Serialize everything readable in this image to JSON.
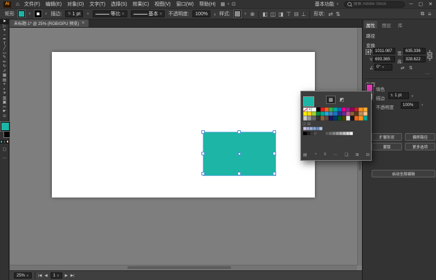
{
  "titlebar": {
    "logo": "Ai",
    "home_icon": "⌂",
    "menus": [
      "文件(F)",
      "编辑(E)",
      "对象(O)",
      "文字(T)",
      "选择(S)",
      "效果(C)",
      "视图(V)",
      "窗口(W)",
      "帮助(H)"
    ],
    "arrange_icon": "▦",
    "share_icon": "⊡",
    "workspace": "基本功能",
    "search_placeholder": "搜索 Adobe Stock",
    "minimize": "─",
    "restore": "▢",
    "close": "✕"
  },
  "control_bar": {
    "context_label": "矩形",
    "fill_color": "#1db5a6",
    "stroke_label": "描边:",
    "stroke_weight": "1 pt",
    "profile_value": "等比",
    "brush_value": "基本",
    "opacity_label": "不透明度:",
    "opacity_value": "100%",
    "opacity_more": "›",
    "style_label": "样式:",
    "doc_icon": "⊕",
    "align_icons": [
      {
        "g": "◧",
        "n": "align-left-icon"
      },
      {
        "g": "◫",
        "n": "align-center-horizontal-icon"
      },
      {
        "g": "◨",
        "n": "align-right-icon"
      },
      {
        "g": "⊤",
        "n": "align-top-icon"
      },
      {
        "g": "⊟",
        "n": "align-middle-icon"
      },
      {
        "g": "⊥",
        "n": "align-bottom-icon"
      }
    ],
    "shape_label": "形状:",
    "shape_icons": [
      {
        "g": "⇄",
        "n": "flip-horizontal-icon"
      },
      {
        "g": "⇅",
        "n": "flip-vertical-icon"
      }
    ],
    "right_icons": [
      {
        "g": "⧉",
        "n": "arrange-documents-icon"
      },
      {
        "g": "≡",
        "n": "panel-menu-icon"
      }
    ]
  },
  "toolbar": {
    "tools": [
      {
        "glyph": "➤",
        "name": "selection-tool",
        "active": true
      },
      {
        "glyph": "▷",
        "name": "direct-selection-tool"
      },
      {
        "glyph": "✶",
        "name": "magic-wand-tool"
      },
      {
        "glyph": "∽",
        "name": "lasso-tool"
      },
      {
        "glyph": "✒",
        "name": "pen-tool"
      },
      {
        "glyph": "T",
        "name": "type-tool"
      },
      {
        "glyph": "╱",
        "name": "line-segment-tool"
      },
      {
        "glyph": "▭",
        "name": "rectangle-tool"
      },
      {
        "glyph": "✎",
        "name": "paintbrush-tool"
      },
      {
        "glyph": "✏",
        "name": "pencil-tool"
      },
      {
        "glyph": "↻",
        "name": "rotate-tool"
      },
      {
        "glyph": "⇗",
        "name": "scale-tool"
      },
      {
        "glyph": "▦",
        "name": "mesh-tool"
      },
      {
        "glyph": "▤",
        "name": "gradient-tool"
      },
      {
        "glyph": "⌖",
        "name": "eyedropper-tool"
      },
      {
        "glyph": "◐",
        "name": "blend-tool"
      },
      {
        "glyph": "✳",
        "name": "symbol-sprayer-tool"
      },
      {
        "glyph": "▥",
        "name": "column-graph-tool"
      },
      {
        "glyph": "▣",
        "name": "artboard-tool"
      },
      {
        "glyph": "✂",
        "name": "slice-tool"
      },
      {
        "glyph": "☛",
        "name": "hand-tool"
      },
      {
        "glyph": "⊙",
        "name": "zoom-tool"
      }
    ],
    "fill_color": "#1db5a6",
    "stroke_color": "#000000",
    "draw_mode_icon": "▢",
    "more_icon": "⋯"
  },
  "doc_tab": {
    "title": "未标题-1* @ 25% (RGB/GPU 预览)",
    "close_icon": "×"
  },
  "shape": {
    "fill_color": "#1db5a6"
  },
  "swatches_panel": {
    "current_color": "#1db5a6",
    "tab_icons": [
      {
        "g": "▦",
        "n": "swatches-view-icon",
        "active": true
      },
      {
        "g": "◩",
        "n": "color-mixer-icon"
      }
    ],
    "grid": [
      "none",
      "reg",
      "#ffffff",
      "#000000",
      "#ed1c24",
      "#f26522",
      "#39b54a",
      "#00a99d",
      "#0072bc",
      "#ec008c",
      "#92278f",
      "#9e005d",
      "#c1272d",
      "#f7931e",
      "#fbb03b",
      "#fff200",
      "#ffde17",
      "#a6ce39",
      "#009245",
      "#00a99d",
      "#29abe2",
      "#4a7ebb",
      "#1b75bc",
      "#2e3192",
      "#662d91",
      "#c4529e",
      "#8c6239",
      "#603813",
      "#bf8f5f",
      "#fdc689",
      "#cccccc",
      "#999999",
      "#666666",
      "#333333",
      "#8c6239",
      "#5b4a42",
      "#1b1464",
      "#003663",
      "#005826",
      "#4d4100",
      "#e8e8e8",
      "#1a1a1a",
      "#f26522",
      "#f7941d",
      "#00a99d"
    ],
    "group_swatches": [
      "#cdc6e4",
      "#b4b4dc",
      "#9db4da",
      "#86a4d0",
      "#7291c5",
      "#b9c6e0"
    ],
    "dark_swatches": [
      "#000000",
      "#232323",
      "#3b3b3b",
      "#515151"
    ],
    "gray_ramp": [
      "#5a5a5a",
      "#6f6f6f",
      "#848484",
      "#999999",
      "#aeaeae",
      "#c3c3c3",
      "#d8d8d8",
      "#f2f2f2"
    ],
    "mini_icons": [
      {
        "g": "❏",
        "n": "color-group-icon"
      },
      {
        "g": "▤",
        "n": "swatch-list-icon"
      }
    ],
    "footer_icons": [
      {
        "g": "▤",
        "n": "swatch-libraries-icon"
      },
      {
        "g": "◔",
        "n": "color-themes-icon"
      },
      {
        "g": "≡",
        "n": "show-swatch-kinds-icon"
      },
      {
        "g": "⋯",
        "n": "swatch-options-icon"
      },
      {
        "g": "❏",
        "n": "new-color-group-icon"
      },
      {
        "g": "⊞",
        "n": "new-swatch-icon"
      },
      {
        "g": "⊟",
        "n": "delete-swatch-icon"
      }
    ]
  },
  "properties": {
    "tabs": [
      {
        "label": "属性",
        "active": true
      },
      {
        "label": "图层",
        "active": false
      },
      {
        "label": "库",
        "active": false
      }
    ],
    "selection_type": "路径",
    "transform_label": "变换",
    "x_label": "X:",
    "x_value": "1011.087",
    "y_label": "Y:",
    "y_value": "693.365",
    "w_label": "宽:",
    "w_value": "635.336",
    "h_label": "高:",
    "h_value": "328.622",
    "angle_icon": "∠",
    "rotation_value": "0°",
    "flip_h_icon": "⇄",
    "flip_v_icon": "⇅",
    "more_icon": "···",
    "appearance_label": "外观",
    "fill_label": "填色",
    "fill_color": "#e23cb4",
    "stroke_label": "描边",
    "stroke_weight": "1 pt",
    "opacity_label": "不透明度",
    "opacity_value": "100%",
    "opacity_more": "›",
    "quick_actions": [
      "扩展形状",
      "偏移路径",
      "蒙版",
      "更多选项"
    ],
    "global_edit_label": "启动全局编辑"
  },
  "status_bar": {
    "zoom_value": "25%",
    "nav_first": "|◀",
    "nav_prev": "◀",
    "artboard_value": "1",
    "nav_next": "▶",
    "nav_last": "▶|"
  }
}
